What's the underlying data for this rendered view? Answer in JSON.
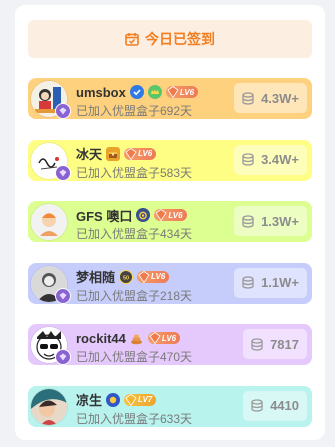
{
  "checkin": {
    "label": "今日已签到",
    "icon": "calendar-check-icon",
    "color": "#f27e1f"
  },
  "users": [
    {
      "name": "umsbox",
      "subtitle": "已加入优盟盒子692天",
      "score": "4.3W+",
      "level": "LV6",
      "bg": "#fed17e",
      "badges": [
        "verified-check-icon",
        "crown-medal-icon"
      ]
    },
    {
      "name": "冰天",
      "subtitle": "已加入优盟盒子583天",
      "score": "3.4W+",
      "level": "LV6",
      "bg": "#fefe84",
      "badges": [
        "treasure-chest-icon"
      ]
    },
    {
      "name": "GFS 噢口",
      "subtitle": "已加入优盟盒子434天",
      "score": "1.3W+",
      "level": "LV6",
      "bg": "#ddfe90",
      "badges": [
        "medal-icon"
      ]
    },
    {
      "name": "梦相随",
      "subtitle": "已加入优盟盒子218天",
      "score": "1.1W+",
      "level": "LV6",
      "bg": "#c6cdfb",
      "badges": [
        "streak-50-icon"
      ]
    },
    {
      "name": "rockit44",
      "subtitle": "已加入优盟盒子470天",
      "score": "7817",
      "level": "LV6",
      "bg": "#e5c9fd",
      "badges": [
        "poop-icon"
      ]
    },
    {
      "name": "凉生",
      "subtitle": "已加入优盟盒子633天",
      "score": "4410",
      "level": "LV7",
      "bg": "#b8f3ee",
      "badges": [
        "gold-badge-icon"
      ]
    }
  ]
}
